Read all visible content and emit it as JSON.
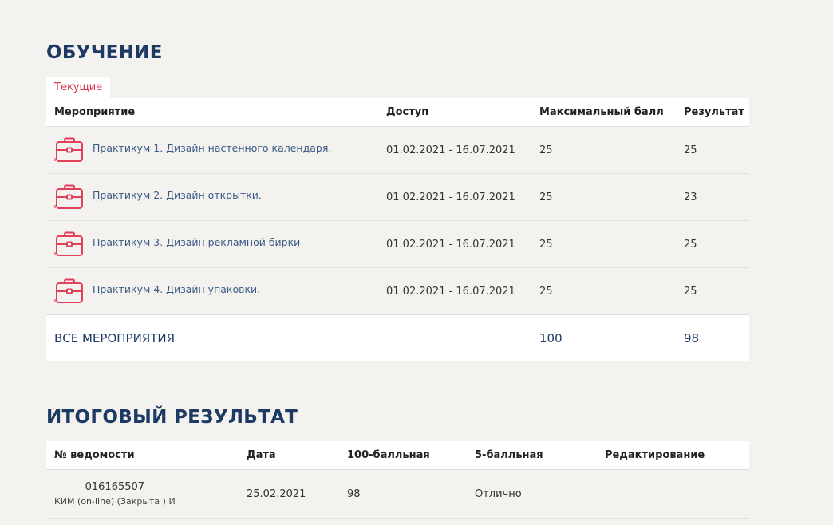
{
  "training": {
    "title": "ОБУЧЕНИЕ",
    "tab_current": "Текущие",
    "headers": {
      "activity": "Мероприятие",
      "access": "Доступ",
      "max_score": "Максимальный балл",
      "result": "Результат"
    },
    "rows": [
      {
        "name": "Практикум 1. Дизайн настенного календаря.",
        "access": "01.02.2021 - 16.07.2021",
        "max": "25",
        "result": "25"
      },
      {
        "name": "Практикум 2. Дизайн открытки.",
        "access": "01.02.2021 - 16.07.2021",
        "max": "25",
        "result": "23"
      },
      {
        "name": "Практикум 3. Дизайн рекламной бирки",
        "access": "01.02.2021 - 16.07.2021",
        "max": "25",
        "result": "25"
      },
      {
        "name": "Практикум 4. Дизайн упаковки.",
        "access": "01.02.2021 - 16.07.2021",
        "max": "25",
        "result": "25"
      }
    ],
    "total": {
      "label": "ВСЕ МЕРОПРИЯТИЯ",
      "max": "100",
      "result": "98"
    },
    "icon": "briefcase-icon",
    "icon_color": "#e0405a"
  },
  "final": {
    "title": "ИТОГОВЫЙ РЕЗУЛЬТАТ",
    "headers": {
      "sheet": "№ ведомости",
      "date": "Дата",
      "score100": "100-балльная",
      "score5": "5-балльная",
      "edit": "Редактирование"
    },
    "rows": [
      {
        "sheet": "016165507",
        "sheet_sub": "КИМ (on-line) (Закрыта ) И",
        "date": "25.02.2021",
        "score100": "98",
        "score5": "Отлично"
      }
    ]
  },
  "colors": {
    "background": "#f3f2ef",
    "title": "#1c3a63",
    "accent": "#d9354d",
    "link": "#3a5a85"
  }
}
